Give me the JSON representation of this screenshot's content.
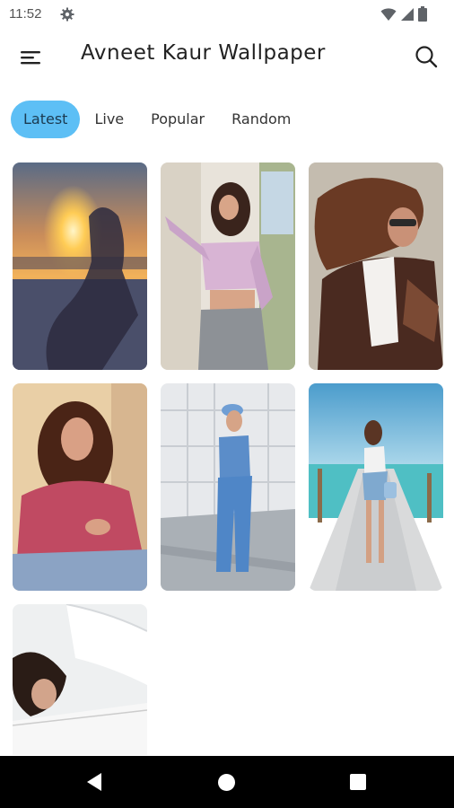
{
  "status_bar": {
    "time": "11:52",
    "icons": [
      "gear-icon",
      "wifi-icon",
      "signal-icon",
      "battery-icon"
    ]
  },
  "app_bar": {
    "title": "Avneet Kaur Wallpaper",
    "menu_icon": "hamburger-menu-icon",
    "search_icon": "search-icon"
  },
  "tabs": [
    {
      "label": "Latest",
      "active": true
    },
    {
      "label": "Live",
      "active": false
    },
    {
      "label": "Popular",
      "active": false
    },
    {
      "label": "Random",
      "active": false
    }
  ],
  "wallpapers": [
    {
      "scene": "sunset silhouette"
    },
    {
      "scene": "pink crop top outfit"
    },
    {
      "scene": "brown jacket windswept hair"
    },
    {
      "scene": "pink top smiling portrait"
    },
    {
      "scene": "denim outfit with cap"
    },
    {
      "scene": "pier by the sea"
    },
    {
      "scene": "white outfit close-up"
    }
  ],
  "nav_bar": {
    "icons": [
      "back-icon",
      "home-icon",
      "recent-apps-icon"
    ]
  },
  "colors": {
    "accent": "#5dbff5",
    "nav_background": "#000000"
  }
}
